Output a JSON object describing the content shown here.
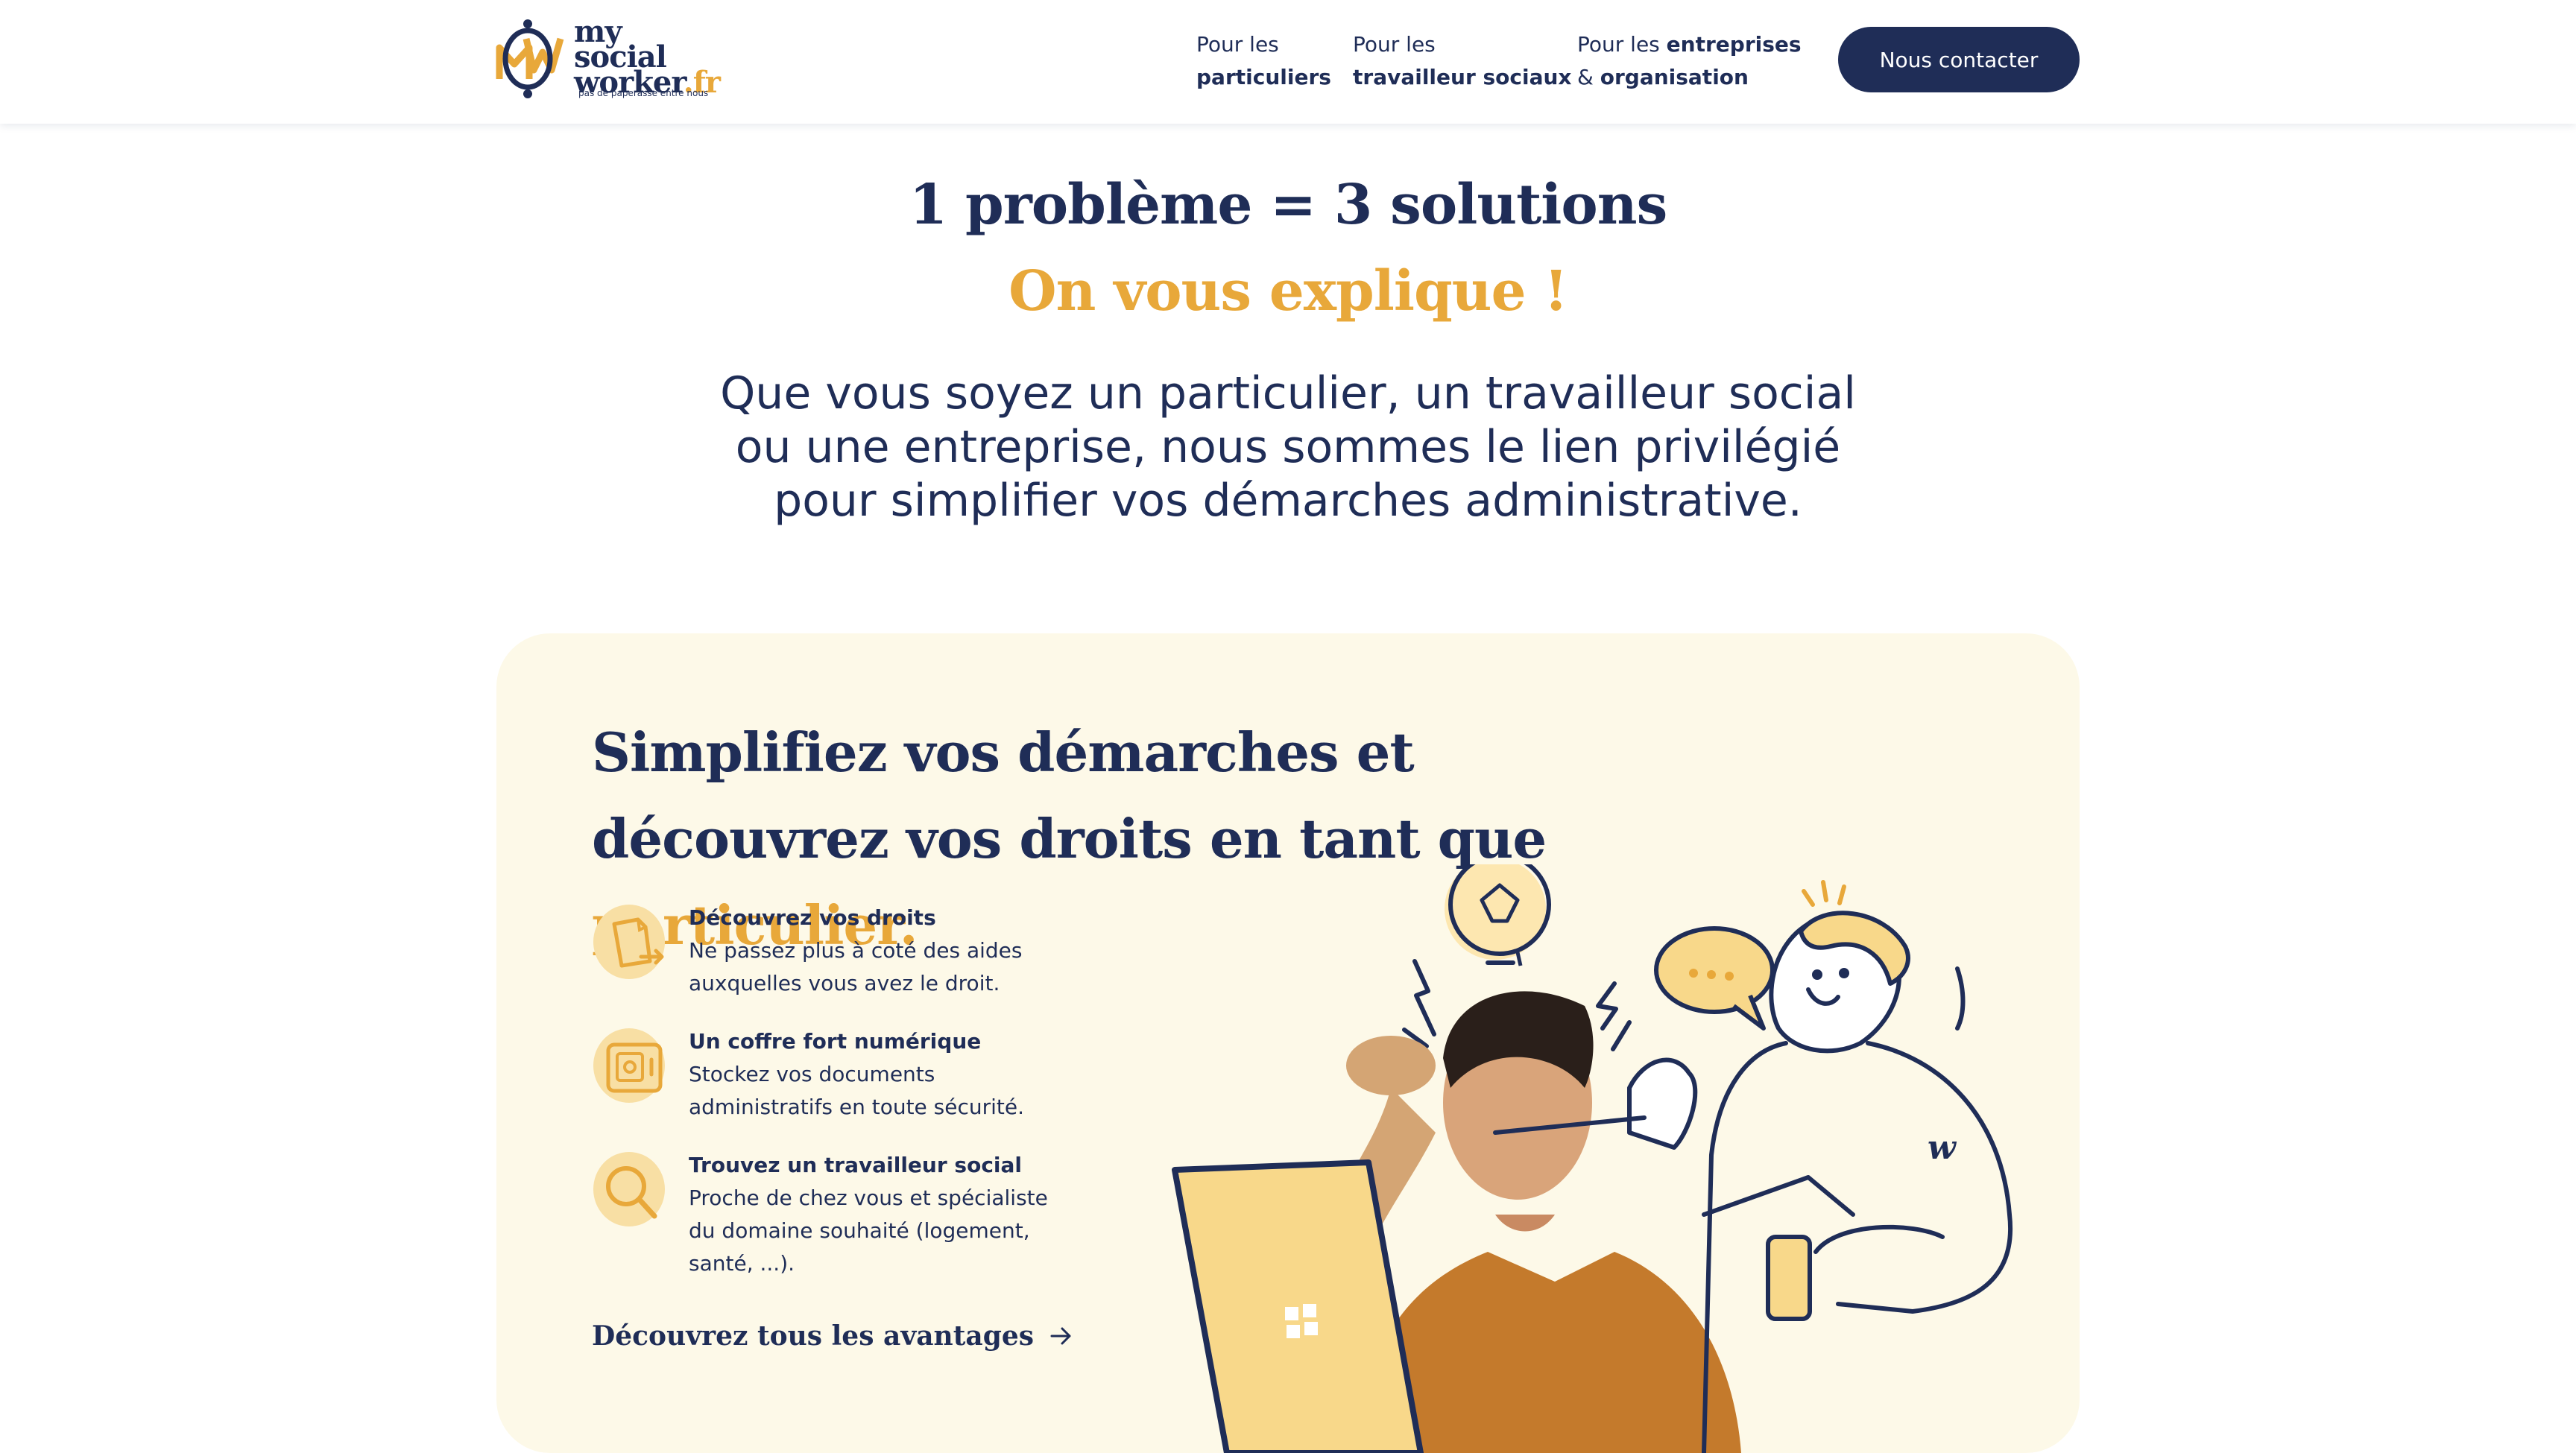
{
  "header": {
    "logo": {
      "line1": "my",
      "line2": "social",
      "line3": "worker",
      "tld": ".fr",
      "tagline": "pas de paperasse entre nous"
    },
    "nav": [
      {
        "line1": "Pour les",
        "line2_bold": "particuliers"
      },
      {
        "line1": "Pour les",
        "line2_bold": "travailleur sociaux"
      },
      {
        "line1_prefix": "Pour les ",
        "line1_bold": "entreprises",
        "line2_prefix": "& ",
        "line2_bold": "organisation"
      }
    ],
    "cta_label": "Nous contacter"
  },
  "hero": {
    "title": "1 problème = 3 solutions",
    "subtitle": "On vous explique !",
    "intro": "Que vous soyez un particulier, un travailleur social ou une entreprise, nous sommes le lien privilégié pour simplifier vos démarches administrative."
  },
  "card": {
    "title_part1": "Simplifiez vos démarches et découvrez vos droits en tant que ",
    "title_accent": "particulier.",
    "features": [
      {
        "icon": "document-arrow-icon",
        "title": "Découvrez vos droits",
        "desc": "Ne passez plus à coté des aides auxquelles vous avez le droit."
      },
      {
        "icon": "safe-icon",
        "title": "Un coffre fort numérique",
        "desc": "Stockez vos documents administratifs en toute sécurité."
      },
      {
        "icon": "magnifier-icon",
        "title": "Trouvez un travailleur social",
        "desc": "Proche de chez vous et spécialiste du domaine souhaité (logement, santé, ...)."
      }
    ],
    "more_link": "Découvrez tous les avantages",
    "illustration": "confused-man-with-laptop-and-social-worker-illustration"
  },
  "colors": {
    "navy": "#1f2d57",
    "accent": "#e8a83a",
    "card_bg": "#fdf9e8"
  }
}
